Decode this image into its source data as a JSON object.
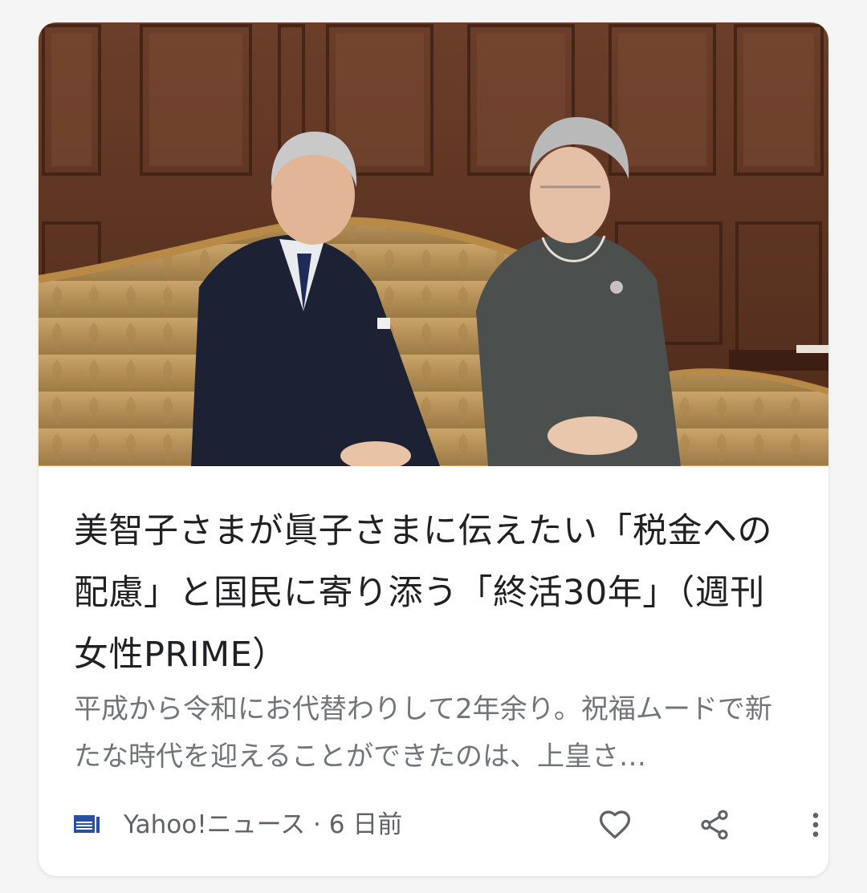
{
  "article": {
    "headline": "美智子さまが眞子さまに伝えたい「税金への配慮」と国民に寄り添う「終活30年」（週刊女性PRIME）",
    "snippet": "平成から令和にお代替わりして2年余り。祝福ムードで新たな時代を迎えることができたのは、上皇さ…",
    "source": "Yahoo!ニュース",
    "separator": "·",
    "age": "6 日前"
  },
  "icons": {
    "photo": "royal-couple-photo",
    "source_logo": "yahoo-news-logo-icon",
    "like": "heart-outline-icon",
    "share": "share-icon",
    "more": "more-vertical-icon"
  },
  "colors": {
    "headline": "#202124",
    "snippet": "#70757a",
    "meta": "#5f6368",
    "card_background": "#ffffff"
  }
}
